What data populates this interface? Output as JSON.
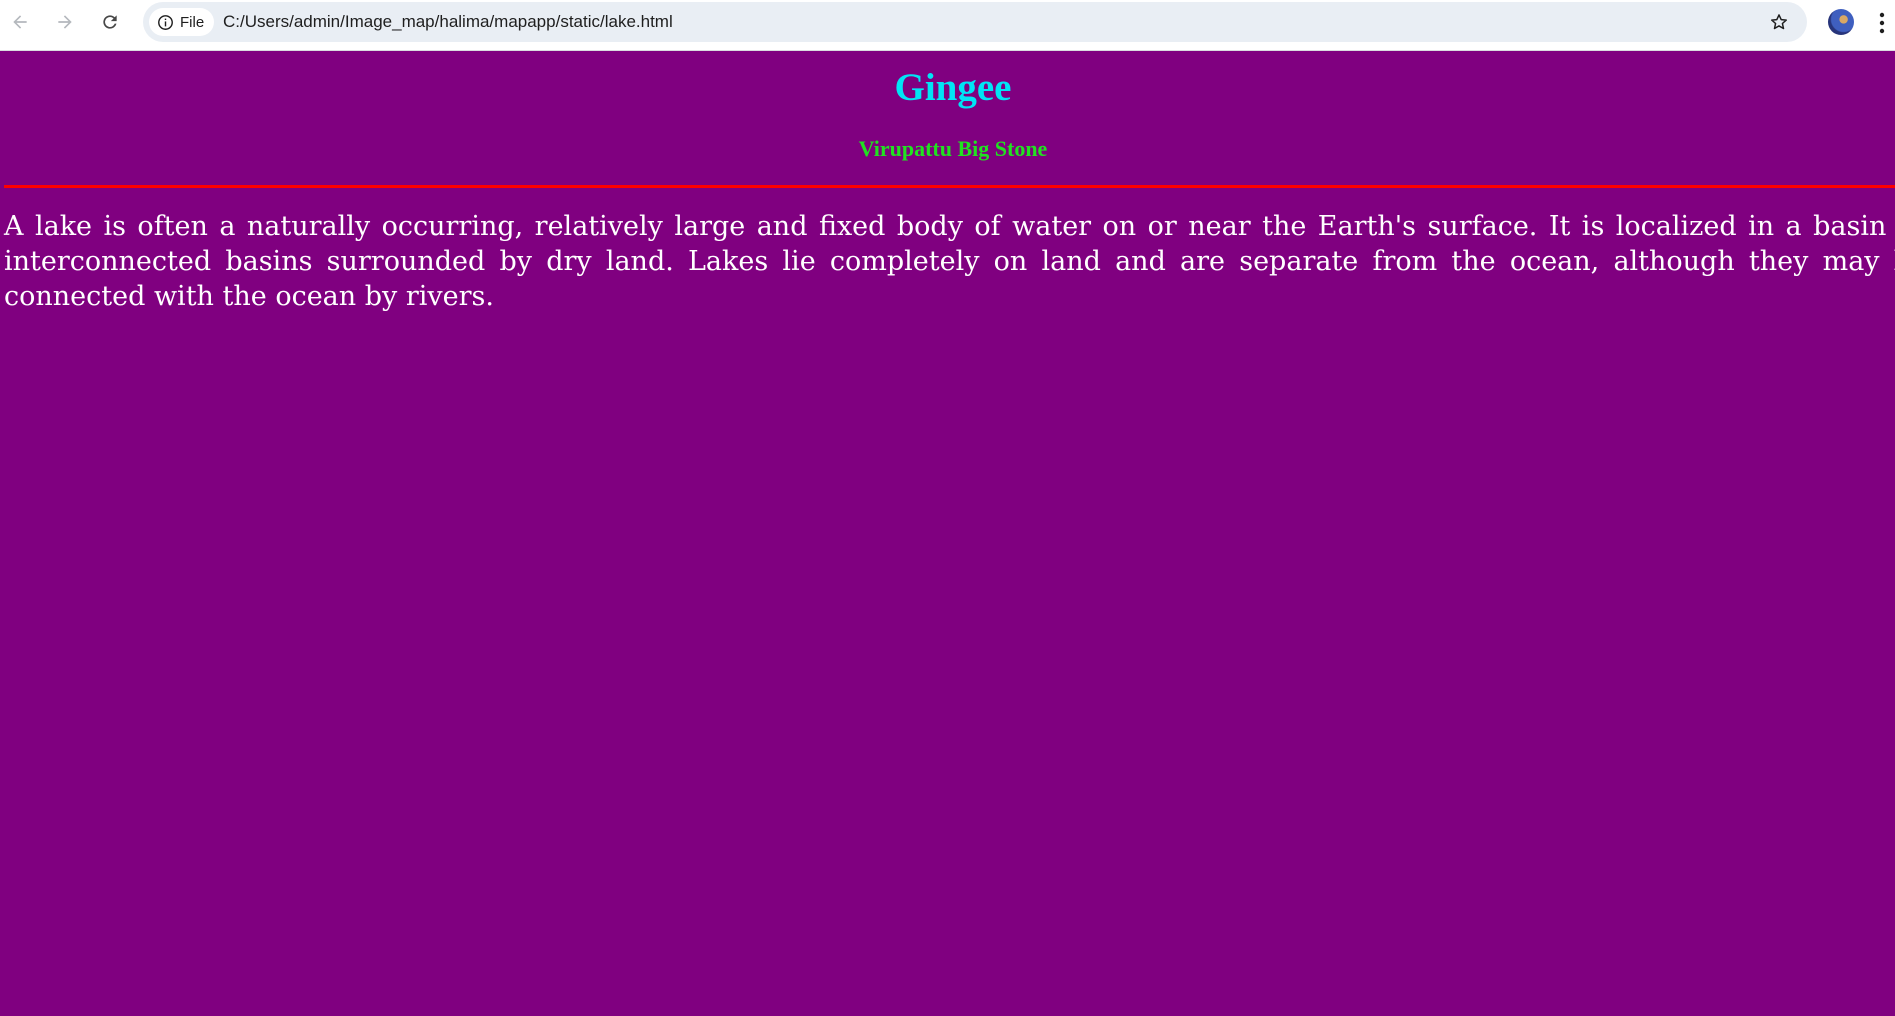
{
  "browser": {
    "site_chip_label": "File",
    "url": "C:/Users/admin/Image_map/halima/mapapp/static/lake.html",
    "icons": {
      "back": "arrow-left-icon",
      "forward": "arrow-right-icon",
      "reload": "reload-icon",
      "site_info": "info-icon",
      "bookmark": "star-icon",
      "menu": "more-vertical-icon"
    }
  },
  "page": {
    "title": "Gingee",
    "subtitle": "Virupattu Big Stone",
    "paragraph": "A lake is often a naturally occurring, relatively large and fixed body of water on or near the Earth's surface. It is localized in a basin or interconnected basins surrounded by dry land. Lakes lie completely on land and are separate from the ocean, although they may be connected with the ocean by rivers.",
    "colors": {
      "background": "#800080",
      "title": "#00e5f5",
      "subtitle": "#21e221",
      "divider": "#ff0000",
      "text": "#ffffff"
    }
  }
}
